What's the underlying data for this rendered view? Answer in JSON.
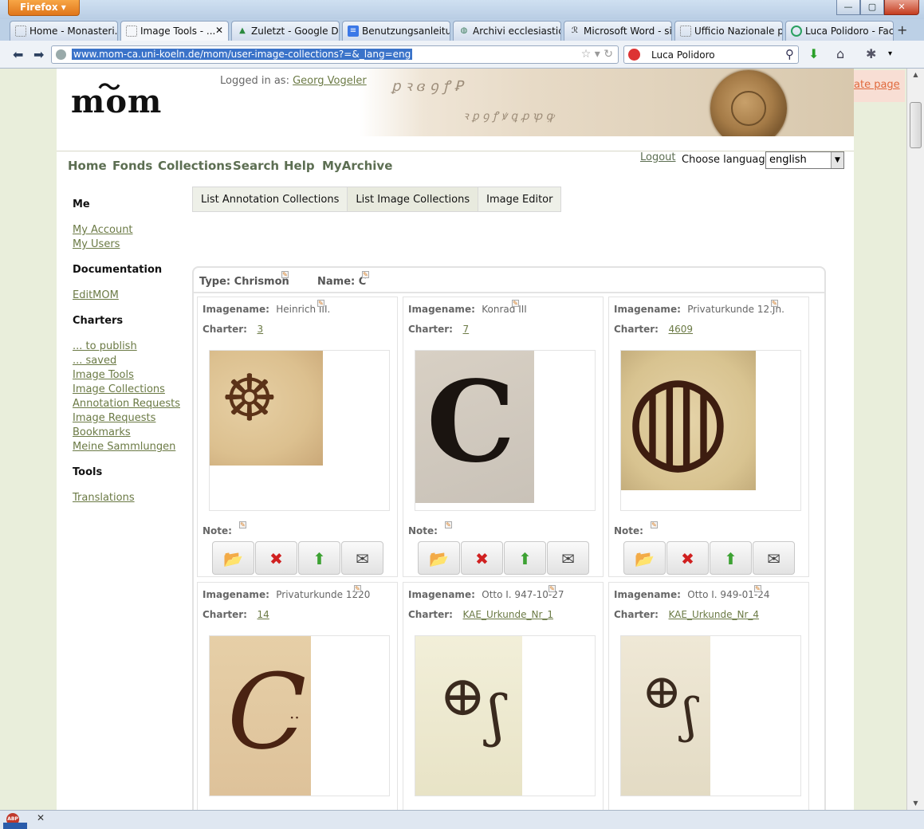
{
  "browser": {
    "firefox_label": "Firefox",
    "tabs": [
      {
        "title": "Home - Monasteri...",
        "icon": "page-icon"
      },
      {
        "title": "Image Tools - ...",
        "icon": "page-icon",
        "active": true
      },
      {
        "title": "Zuletzt - Google Dr...",
        "icon": "google-drive-icon"
      },
      {
        "title": "Benutzungsanleitu...",
        "icon": "docs-icon"
      },
      {
        "title": "Archivi ecclesiastici...",
        "icon": "globe-icon"
      },
      {
        "title": "Microsoft Word - si...",
        "icon": "pdf-icon"
      },
      {
        "title": "Ufficio Nazionale p...",
        "icon": "page-icon"
      },
      {
        "title": "Luca Polidoro - Fac...",
        "icon": "loading-icon"
      }
    ],
    "url": "www.mom-ca.uni-koeln.de/mom/user-image-collections?=&_lang=eng",
    "search_value": "Luca Polidoro"
  },
  "header": {
    "logo": "mom",
    "logged_in_label": "Logged in as:",
    "user_name": "Georg Vogeler",
    "create_page": "ate page"
  },
  "nav": {
    "items": [
      "Home",
      "Fonds",
      "Collections",
      "Search",
      "Help",
      "MyArchive"
    ],
    "logout": "Logout",
    "language_label": "Choose language",
    "language_value": "english"
  },
  "sidebar": {
    "me_heading": "Me",
    "me_links": [
      "My Account",
      "My Users"
    ],
    "doc_heading": "Documentation",
    "doc_links": [
      "EditMOM"
    ],
    "charters_heading": "Charters",
    "charters_links": [
      "... to publish",
      "... saved",
      "Image Tools",
      "Image Collections",
      "Annotation Requests",
      "Image Requests",
      "Bookmarks",
      "Meine Sammlungen"
    ],
    "tools_heading": "Tools",
    "tools_links": [
      "Translations"
    ]
  },
  "tabs": [
    "List Annotation Collections",
    "List Image Collections",
    "Image Editor"
  ],
  "collection": {
    "type_label": "Type:",
    "type_value": "Chrismon",
    "name_label": "Name:",
    "name_value": "C",
    "imagename_label": "Imagename:",
    "charter_label": "Charter:",
    "note_label": "Note:",
    "cards": [
      {
        "imagename": "Heinrich III.",
        "charter": "3"
      },
      {
        "imagename": "Konrad III",
        "charter": "7"
      },
      {
        "imagename": "Privaturkunde 12.Jh.",
        "charter": "4609"
      },
      {
        "imagename": "Privaturkunde 1220",
        "charter": "14"
      },
      {
        "imagename": "Otto I. 947-10-27",
        "charter": "KAE_Urkunde_Nr_1"
      },
      {
        "imagename": "Otto I. 949-01-24",
        "charter": "KAE_Urkunde_Nr_4"
      }
    ]
  }
}
